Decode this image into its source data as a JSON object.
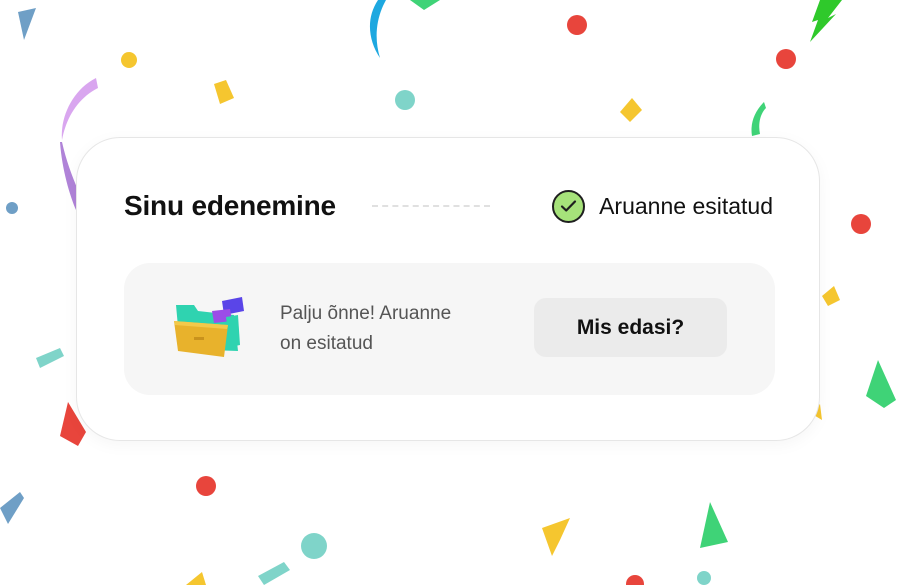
{
  "progress": {
    "title": "Sinu edenemine",
    "status_label": "Aruanne esitatud",
    "status_icon": "check-icon"
  },
  "panel": {
    "message_line1": "Palju õnne! Aruanne",
    "message_line2": "on esitatud",
    "next_button_label": "Mis edasi?",
    "illustration_icon": "folder-icon"
  },
  "colors": {
    "check_fill": "#a6e27a",
    "panel_bg": "#f6f6f6",
    "button_bg": "#ebebeb",
    "confetti": [
      "#e8453c",
      "#f5c62f",
      "#7fd4c9",
      "#3fd377",
      "#1ea8e0",
      "#6f9fc6",
      "#d9a6ef",
      "#b083d8"
    ]
  }
}
